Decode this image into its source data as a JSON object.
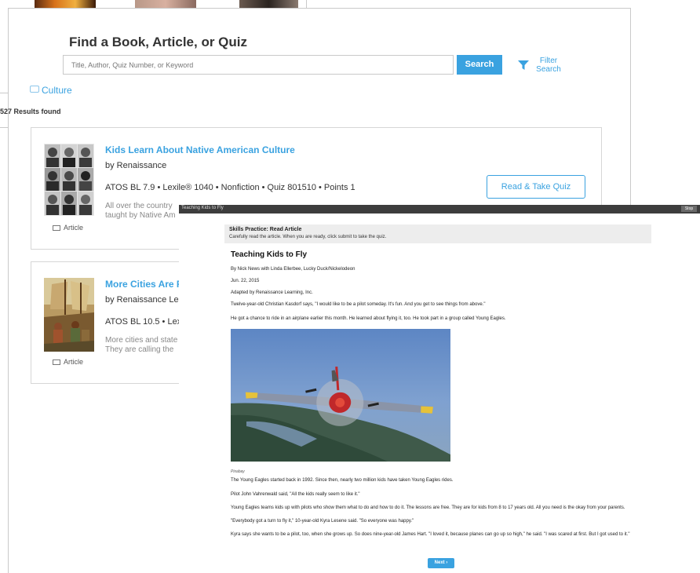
{
  "search": {
    "title": "Find a Book, Article, or Quiz",
    "placeholder": "Title, Author, Quiz Number, or Keyword",
    "button_label": "Search",
    "filter_label_line1": "Filter",
    "filter_label_line2": "Search"
  },
  "topic": {
    "label": "Culture"
  },
  "results": {
    "count_text": "527 Results found"
  },
  "books": [
    {
      "title": "Kids Learn About Native American Culture",
      "author": "by Renaissance",
      "meta": "ATOS BL 7.9 • Lexile® 1040 • Nonfiction • Quiz 801510 • Points 1",
      "desc_line1": "All over the country",
      "desc_line2": "taught by Native Am",
      "type_label": "Article",
      "action_label": "Read & Take Quiz"
    },
    {
      "title": "More Cities Are R",
      "author": "by Renaissance Lea",
      "meta": "ATOS BL 10.5 • Lex",
      "desc_line1": "More cities and state",
      "desc_line2": "They are calling the",
      "type_label": "Article"
    }
  ],
  "overlay": {
    "window_title": "Teaching Kids to Fly",
    "window_button": "Stop",
    "skills_title": "Skills Practice: Read Article",
    "skills_subtitle": "Carefully read the article. When you are ready, click submit to take the quiz.",
    "article_title": "Teaching Kids to Fly",
    "byline": "By Nick News with Linda Ellerbee, Lucky Duck/Nickelodeon",
    "date": "Jun. 22, 2015",
    "adapted": "Adapted by Renaissance Learning, Inc.",
    "para1": "Twelve-year-old Christian Kasdorf says, \"I would like to be a pilot someday. It's fun. And you get to see things from above.\"",
    "para2": "He got a chance to ride in an airplane earlier this month. He learned about flying it, too. He took part in a group called Young Eagles.",
    "photo_caption": "Pixabay",
    "para3": "The Young Eagles started back in 1992. Since then, nearly two million kids have taken Young Eagles rides.",
    "para4": "Pilot John Vahrenwald said, \"All the kids really seem to like it.\"",
    "para5": "Young Eagles teams kids up with pilots who show them what to do and how to do it. The lessons are free. They are for kids from 8 to 17 years old. All you need is the okay from your parents.",
    "para6": "\"Everybody got a turn to fly it,\" 10-year-old Kyra Lesene said. \"So everyone was happy.\"",
    "para7": "Kyra says she wants to be a pilot, too, when she grows up. So does nine-year-old James Hart. \"I loved it, because planes can go up so high,\" he said. \"I was scared at first. But I got used to it.\"",
    "next_label": "Next ›"
  },
  "colors": {
    "accent": "#3aa2e0",
    "overlay_bar": "#3d3d3d"
  }
}
